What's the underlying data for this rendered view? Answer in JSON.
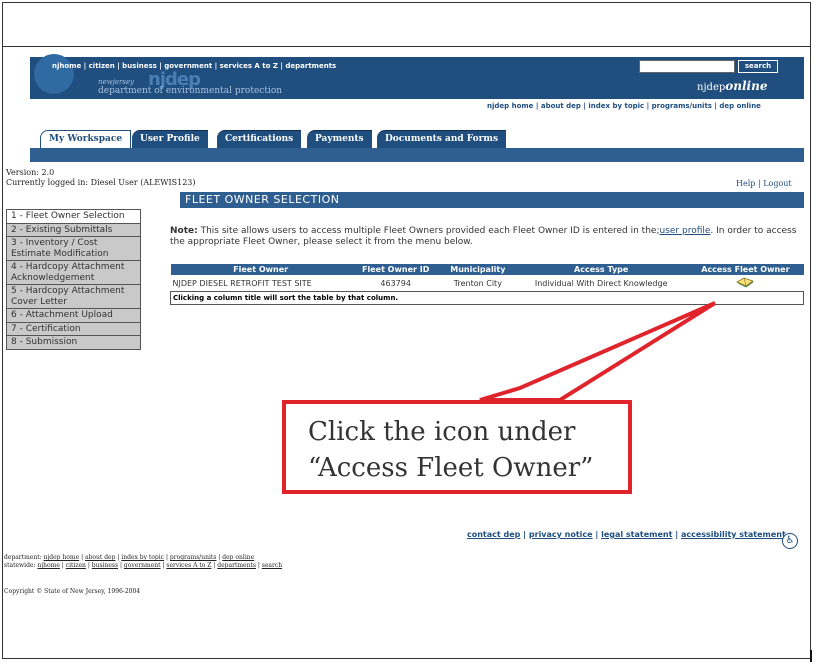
{
  "header": {
    "top_links": "njhome | citizen | business | government | services A to Z | departments",
    "brand_small": "newjersey",
    "brand_big": "njdep",
    "brand_sub": "department of environmental protection",
    "search_label": "search",
    "online_prefix": "njdep",
    "online_suffix": "online",
    "sub_links": "njdep home | about dep | index by topic | programs/units | dep online"
  },
  "tabs": [
    {
      "label": "My Workspace"
    },
    {
      "label": "User Profile"
    },
    {
      "label": "Certifications"
    },
    {
      "label": "Payments"
    },
    {
      "label": "Documents and Forms"
    }
  ],
  "session": {
    "version": "Version: 2.0",
    "logged_in": "Currently logged in: Diesel User (ALEWIS123)",
    "help": "Help",
    "separator": "|",
    "logout": "Logout"
  },
  "section_title": "FLEET OWNER SELECTION",
  "sidenav": [
    {
      "label": "1 - Fleet Owner Selection"
    },
    {
      "label": "2 - Existing Submittals"
    },
    {
      "label": "3 - Inventory / Cost Estimate Modification"
    },
    {
      "label": "4 - Hardcopy Attachment Acknowledgement"
    },
    {
      "label": "5 - Hardcopy Attachment Cover Letter"
    },
    {
      "label": "6 - Attachment Upload"
    },
    {
      "label": "7 - Certification"
    },
    {
      "label": "8 - Submission"
    }
  ],
  "note": {
    "label": "Note:",
    "text": "This site allows users to access multiple Fleet Owners provided each Fleet Owner ID is entered in the;",
    "link": "user profile",
    "text2": ". In order to access the appropriate Fleet Owner, please select it from the menu below."
  },
  "table": {
    "headers": [
      "Fleet Owner",
      "Fleet Owner ID",
      "Municipality",
      "Access Type",
      "Access Fleet Owner"
    ],
    "rows": [
      {
        "owner": "NJDEP DIESEL RETROFIT TEST SITE",
        "id": "463794",
        "municipality": "Trenton City",
        "access_type": "Individual With Direct Knowledge"
      }
    ],
    "footer": "Clicking a column title will sort the table by that column."
  },
  "footer": {
    "links": [
      "contact dep",
      "privacy notice",
      "legal statement",
      "accessibility statement"
    ],
    "dept_prefix": "department:",
    "dept_links": [
      "njdep home",
      "about dep",
      "index by topic",
      "programs/units",
      "dep online"
    ],
    "state_prefix": "statewide:",
    "state_links": [
      "njhome",
      "citizen",
      "business",
      "government",
      "services A to Z",
      "departments",
      "search"
    ],
    "copyright": "Copyright © State of New Jersey, 1996-2004"
  },
  "callout": {
    "line1": "Click the icon under",
    "line2": "“Access Fleet Owner”"
  },
  "colors": {
    "navy": "#1f4e7f",
    "bar": "#2f5e90",
    "callout": "#e0242c"
  }
}
